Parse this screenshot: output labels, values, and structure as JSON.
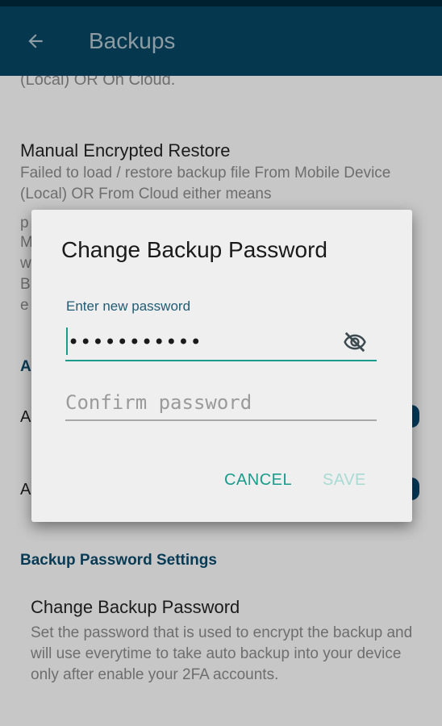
{
  "app_bar": {
    "title": "Backups",
    "back_icon": "arrow-left-icon"
  },
  "background": {
    "top_fragment": "(Local) OR On Cloud.",
    "manual_restore": {
      "title": "Manual Encrypted Restore",
      "summary": "Failed to load / restore backup file From Mobile Device (Local) OR From Cloud either means"
    },
    "section_header_letter": "A",
    "item_peek_1": "A",
    "item_peek_2": "A",
    "left_edge_letters": [
      "p",
      "M",
      "w",
      "B",
      "e"
    ],
    "password_section_header": "Backup Password Settings",
    "change_password": {
      "title": "Change Backup Password",
      "summary": "Set the password that is used to encrypt the backup and will use everytime to take auto backup into your device only after enable your 2FA accounts."
    }
  },
  "dialog": {
    "title": "Change Backup Password",
    "new_password_label": "Enter new password",
    "new_password_value": "•••••••••••",
    "visibility_icon": "eye-off-icon",
    "confirm_placeholder": "Confirm password",
    "cancel_label": "CANCEL",
    "save_label": "SAVE"
  },
  "colors": {
    "app_bar": "#05384f",
    "accent": "#1a9b8b",
    "section_header": "#083b55",
    "dialog_bg": "#efefef",
    "save_disabled": "#a8dbd3"
  }
}
